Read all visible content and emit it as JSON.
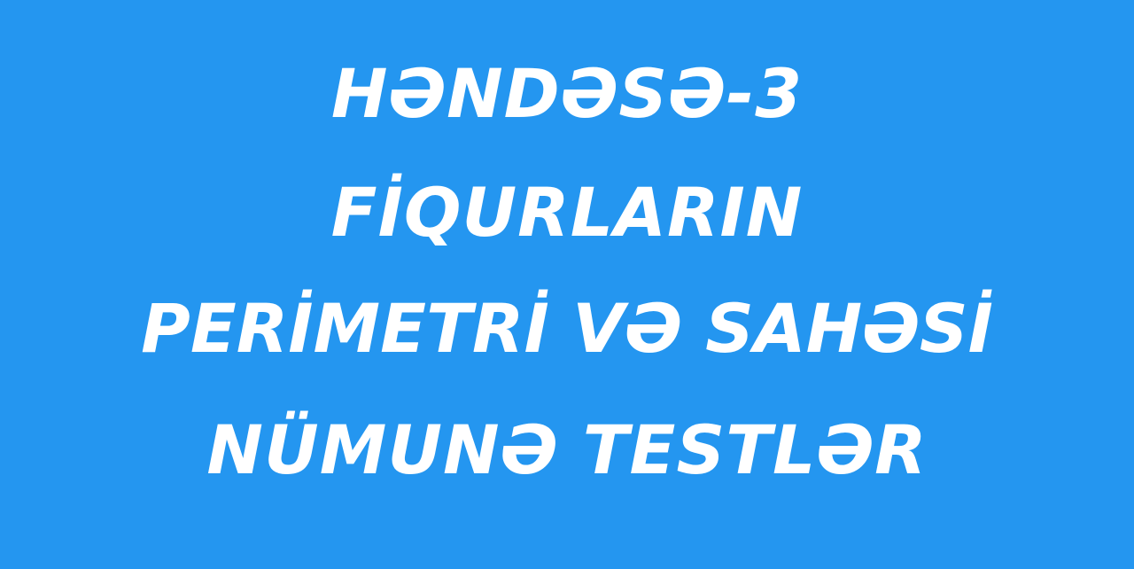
{
  "banner": {
    "lines": [
      "HƏNDƏSƏ-3",
      "FİQURLARIN",
      "PERİMETRİ VƏ SAHƏSİ",
      "NÜMUNƏ TESTLƏR"
    ],
    "colors": {
      "background": "#2496f0",
      "text": "#ffffff"
    }
  }
}
